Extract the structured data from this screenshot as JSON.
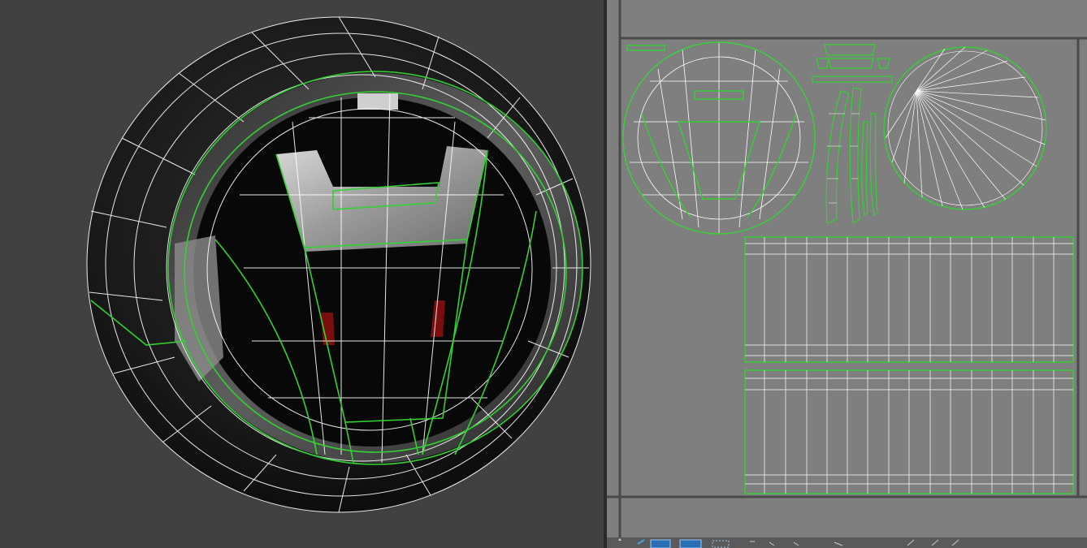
{
  "viewport": {
    "name": "3d-viewport"
  },
  "uv_editor": {
    "name": "uv-editor"
  },
  "toolbar": {
    "icons": [
      "move-icon",
      "select-icon",
      "frame-icon",
      "texture-icon",
      "marquee-icon"
    ]
  },
  "colors": {
    "viewport_bg": "#414141",
    "uv_bg": "#7f7f7f",
    "seam_green": "#32d232",
    "wire_white": "#ffffff"
  }
}
